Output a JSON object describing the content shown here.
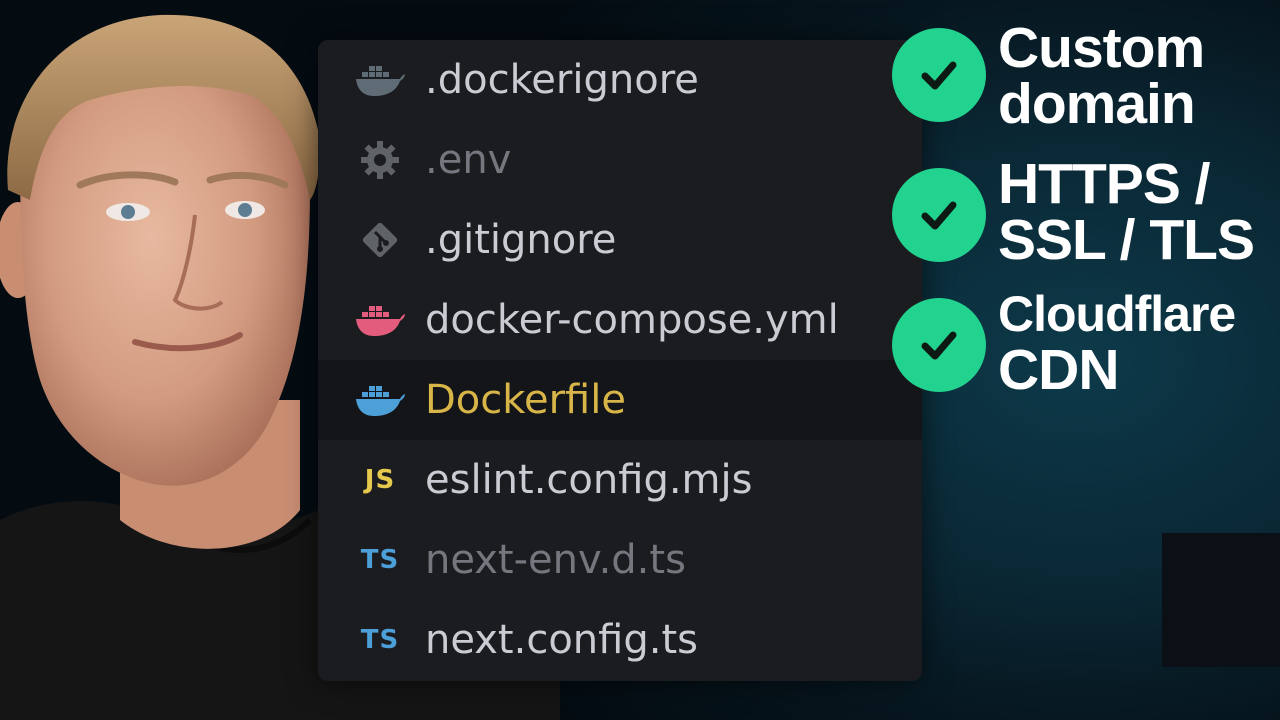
{
  "explorer": {
    "files": [
      {
        "name": ".dockerignore",
        "icon": "docker-icon",
        "icon_color": "#5f6b75",
        "style": "normal"
      },
      {
        "name": ".env",
        "icon": "gear-icon",
        "icon_color": "#5f6368",
        "style": "dim"
      },
      {
        "name": ".gitignore",
        "icon": "git-icon",
        "icon_color": "#5f6368",
        "style": "normal"
      },
      {
        "name": "docker-compose.yml",
        "icon": "docker-icon",
        "icon_color": "#e45c7d",
        "style": "normal"
      },
      {
        "name": "Dockerfile",
        "icon": "docker-icon",
        "icon_color": "#4d9fd8",
        "style": "accent",
        "selected": true
      },
      {
        "name": "eslint.config.mjs",
        "icon": "js-icon",
        "badge": "JS",
        "icon_color": "#e6c84d",
        "style": "normal"
      },
      {
        "name": "next-env.d.ts",
        "icon": "ts-icon",
        "badge": "TS",
        "icon_color": "#4d9fd8",
        "style": "dim"
      },
      {
        "name": "next.config.ts",
        "icon": "ts-icon",
        "badge": "TS",
        "icon_color": "#4d9fd8",
        "style": "normal"
      }
    ]
  },
  "checklist": [
    {
      "lines": [
        "Custom",
        "domain"
      ]
    },
    {
      "lines": [
        "HTTPS /",
        "SSL / TLS"
      ]
    },
    {
      "lines": [
        "Cloudflare",
        "CDN"
      ]
    }
  ],
  "colors": {
    "check_green": "#22d38f",
    "selected_text": "#d8b549",
    "panel_bg": "#1b1c20"
  }
}
